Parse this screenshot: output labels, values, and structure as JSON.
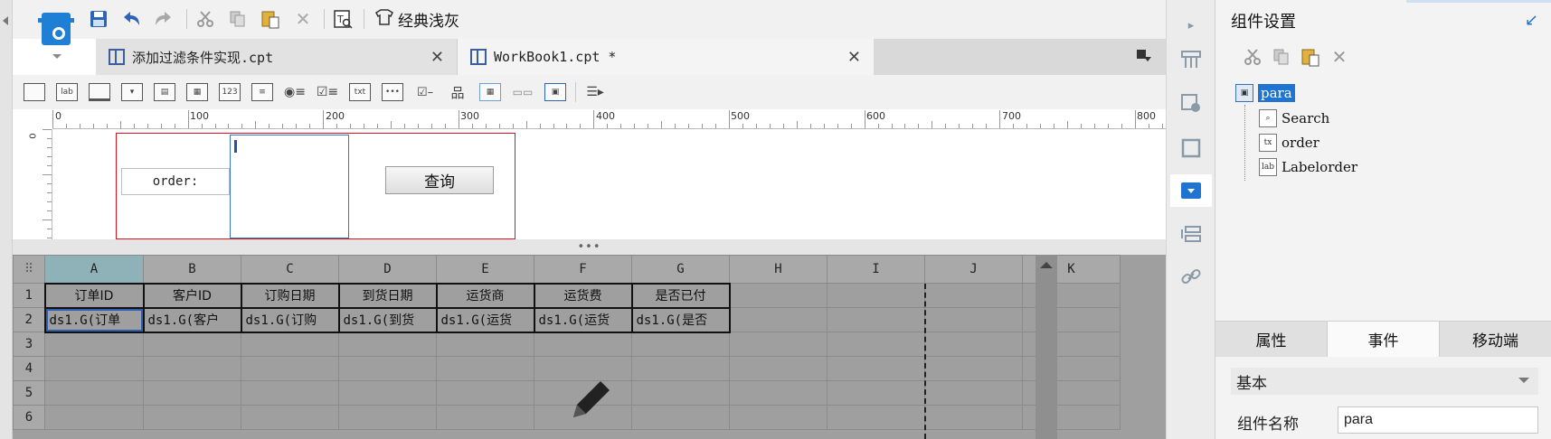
{
  "toolbar": {
    "icons": [
      "save-icon",
      "undo-icon",
      "redo-icon",
      "cut-icon",
      "copy-icon",
      "paste-icon",
      "delete-icon",
      "template-icon",
      "theme-icon"
    ],
    "theme_label": "经典浅灰"
  },
  "tabs": [
    {
      "label": "添加过滤条件实现.cpt",
      "active": false
    },
    {
      "label": "WorkBook1.cpt *",
      "active": true
    }
  ],
  "ruler": {
    "labels": [
      "0",
      "100",
      "200",
      "300",
      "400",
      "500",
      "600",
      "700",
      "800"
    ],
    "vertical_label": "0"
  },
  "design": {
    "label_text": "order:",
    "button_text": "查询"
  },
  "splitter_text": "•••",
  "sheet": {
    "columns": [
      "A",
      "B",
      "C",
      "D",
      "E",
      "F",
      "G",
      "H",
      "I",
      "J",
      "K"
    ],
    "rows": [
      "1",
      "2",
      "3",
      "4",
      "5",
      "6"
    ],
    "headers": [
      "订单ID",
      "客户ID",
      "订购日期",
      "到货日期",
      "运货商",
      "运货费",
      "是否已付"
    ],
    "data": [
      "ds1.G(订单",
      "ds1.G(客户",
      "ds1.G(订购",
      "ds1.G(到货",
      "ds1.G(运货",
      "ds1.G(运货",
      "ds1.G(是否"
    ]
  },
  "panel": {
    "title": "组件设置",
    "tree": [
      {
        "label": "para",
        "icon": "lab-icon",
        "selected": true
      },
      {
        "label": "Search",
        "icon": "search-icon"
      },
      {
        "label": "order",
        "icon": "tx"
      },
      {
        "label": "Labelorder",
        "icon": "lab"
      }
    ],
    "tabs": [
      "属性",
      "事件",
      "移动端"
    ],
    "section": "基本",
    "name_label": "组件名称",
    "name_value": "para"
  },
  "colors": {
    "accent": "#1e74d0",
    "frame": "#e0121f",
    "sheet_bg": "#9f9f9f"
  }
}
